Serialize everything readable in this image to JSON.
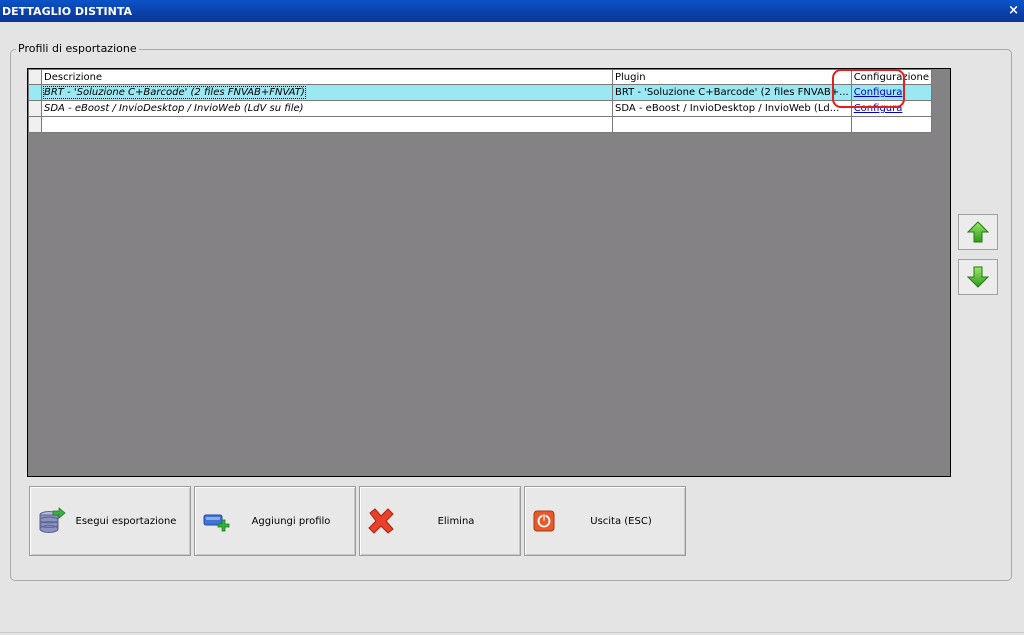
{
  "window": {
    "title": "DETTAGLIO DISTINTA",
    "close_glyph": "×"
  },
  "group": {
    "label": "Profili di esportazione"
  },
  "grid": {
    "columns": [
      "Descrizione",
      "Plugin",
      "Configurazione"
    ],
    "rows": [
      {
        "descrizione": "BRT - 'Soluzione C+Barcode' (2 files FNVAB+FNVAT)",
        "plugin": "BRT - 'Soluzione C+Barcode' (2 files FNVAB+...",
        "configurazione": "Configura",
        "selected": true
      },
      {
        "descrizione": "SDA - eBoost / InvioDesktop / InvioWeb (LdV su file)",
        "plugin": "SDA - eBoost / InvioDesktop / InvioWeb (Ld...",
        "configurazione": "Configura",
        "selected": false
      }
    ]
  },
  "side": {
    "up_icon": "arrow-up-icon",
    "down_icon": "arrow-down-icon"
  },
  "buttons": {
    "export": {
      "label": "Esegui esportazione",
      "icon": "database-export-icon"
    },
    "add": {
      "label": "Aggiungi profilo",
      "icon": "add-profile-icon"
    },
    "delete": {
      "label": "Elimina",
      "icon": "red-x-icon"
    },
    "exit": {
      "label": "Uscita (ESC)",
      "icon": "power-icon"
    }
  },
  "colors": {
    "selected_row": "#9ae8f2",
    "grid_bg": "#858285",
    "title_bar": "#0b3fa8",
    "highlight": "#e0201e"
  }
}
